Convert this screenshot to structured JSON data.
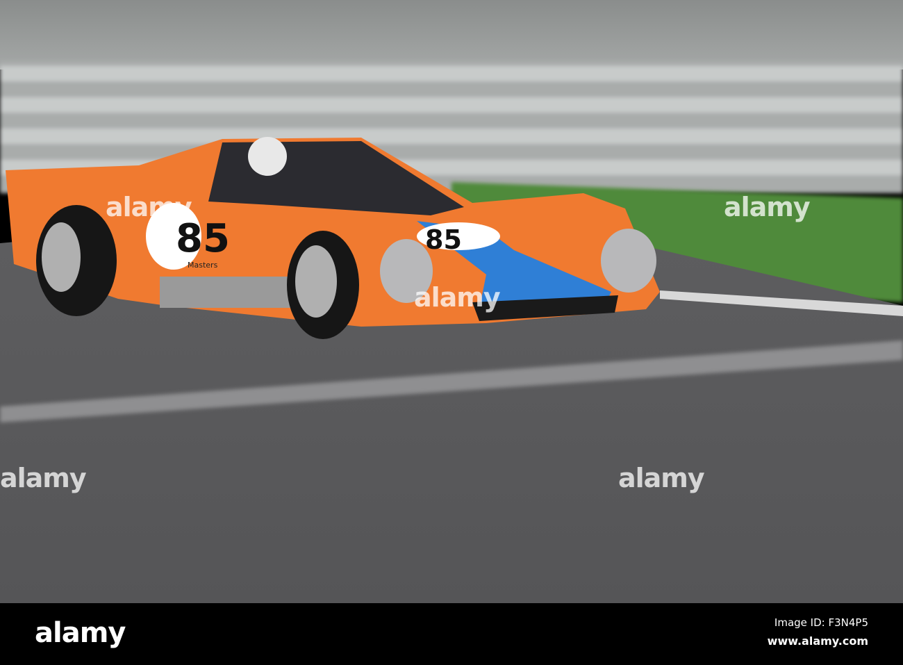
{
  "photo": {
    "subject": "orange racing car",
    "car_number": "85",
    "sponsor_text": "Masters",
    "colors": {
      "car": "#f07a30",
      "stripe": "#2f7fd6",
      "track": "#5c5c5e",
      "grass": "#4f8a3a",
      "barrier": "#b9bcbc"
    }
  },
  "watermark": {
    "text": "alamy"
  },
  "footer": {
    "logo": "alamy",
    "image_id": "Image ID: F3N4P5",
    "website": "www.alamy.com"
  }
}
